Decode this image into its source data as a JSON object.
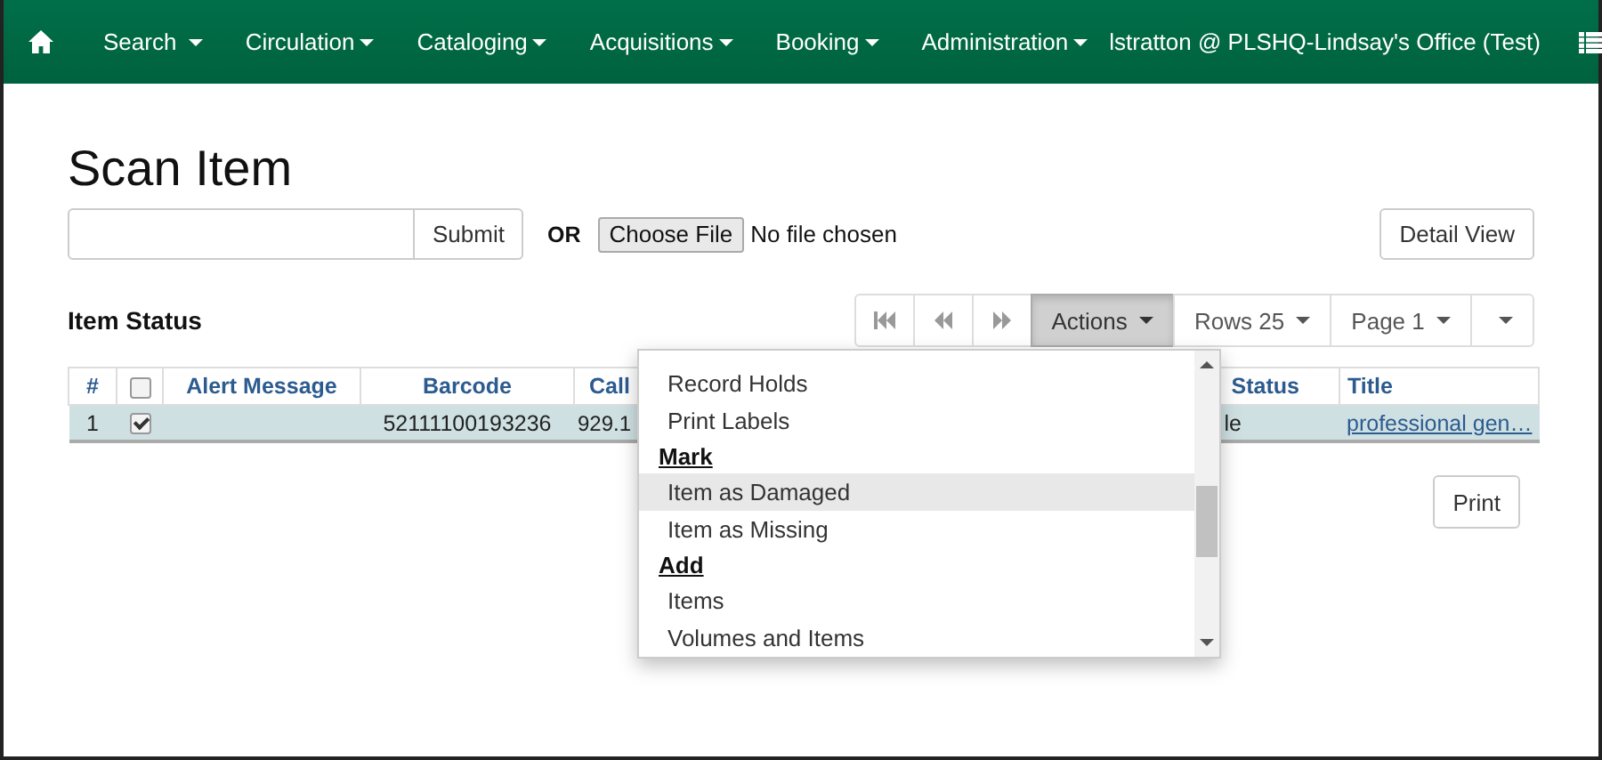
{
  "navbar": {
    "menus": [
      {
        "label": "Search"
      },
      {
        "label": "Circulation"
      },
      {
        "label": "Cataloging"
      },
      {
        "label": "Acquisitions"
      },
      {
        "label": "Booking"
      },
      {
        "label": "Administration"
      }
    ],
    "user": "lstratton @ PLSHQ-Lindsay's Office (Test)"
  },
  "page": {
    "title": "Scan Item",
    "submit": "Submit",
    "or_label": "OR",
    "file_button": "Choose File",
    "file_status": "No file chosen",
    "detail_view": "Detail View"
  },
  "item_status": {
    "heading": "Item Status",
    "pager": [
      {
        "kind": "first"
      },
      {
        "kind": "prev"
      },
      {
        "kind": "next"
      },
      {
        "kind": "menu",
        "label": "Actions",
        "selected": true
      },
      {
        "kind": "menu",
        "label": "Rows 25",
        "selected": false
      },
      {
        "kind": "menu",
        "label": "Page 1",
        "selected": false
      },
      {
        "kind": "caret",
        "selected": false
      }
    ],
    "columns": [
      {
        "kind": "text",
        "label": "#"
      },
      {
        "kind": "checkbox",
        "checked": false
      },
      {
        "kind": "text",
        "label": "Alert Message"
      },
      {
        "kind": "text",
        "label": "Barcode"
      },
      {
        "kind": "text",
        "label": "Call"
      },
      {
        "kind": "text",
        "label": "Status"
      },
      {
        "kind": "text",
        "label": "Title"
      }
    ],
    "rows": [
      {
        "selected": true,
        "cells": [
          {
            "kind": "text",
            "text": "1"
          },
          {
            "kind": "checkbox",
            "checked": true
          },
          {
            "kind": "blank"
          },
          {
            "kind": "text",
            "text": "52111100193236"
          },
          {
            "kind": "text",
            "text": "929.1"
          },
          {
            "kind": "text",
            "text": "le"
          },
          {
            "kind": "link",
            "text": "professional gen…"
          }
        ]
      }
    ],
    "print": "Print"
  },
  "actions_menu": {
    "items": [
      {
        "kind": "item",
        "label": "Record Holds",
        "selected": false
      },
      {
        "kind": "item",
        "label": "Print Labels",
        "selected": false
      },
      {
        "kind": "header",
        "label": "Mark"
      },
      {
        "kind": "item",
        "label": "Item as Damaged",
        "selected": true
      },
      {
        "kind": "item",
        "label": "Item as Missing",
        "selected": false
      },
      {
        "kind": "header",
        "label": "Add"
      },
      {
        "kind": "item",
        "label": "Items",
        "selected": false
      },
      {
        "kind": "item",
        "label": "Volumes and Items",
        "selected": false
      }
    ]
  }
}
